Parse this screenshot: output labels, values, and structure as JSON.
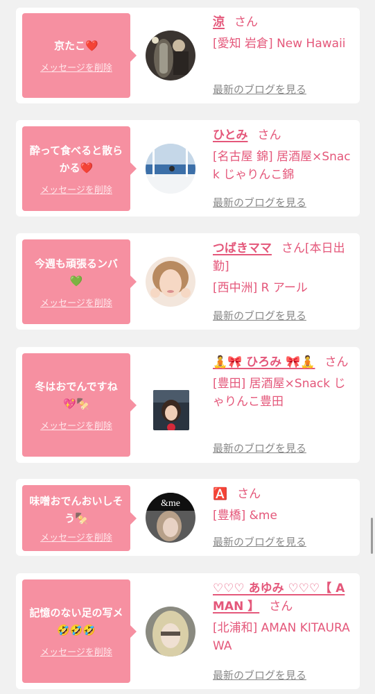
{
  "common": {
    "delete_label": "メッセージを削除",
    "blog_label": "最新のブログを見る",
    "san": "さん"
  },
  "cards": [
    {
      "message": "京たこ❤️",
      "name": "涼",
      "name_suffix": "さん",
      "shop": "[愛知 岩倉] New Hawaii"
    },
    {
      "message": "酔って食べると散らかる❤️",
      "name": "ひとみ",
      "name_suffix": "さん",
      "shop": "[名古屋 錦] 居酒屋×Snack じゃりんこ錦"
    },
    {
      "message": "今週も頑張るンバ💚",
      "name": "つばきママ",
      "name_suffix": "さん[本日出勤]",
      "shop": "[西中洲] R アール"
    },
    {
      "message": "冬はおでんですね💖🍢",
      "name": "🧘🎀 ひろみ 🎀🧘",
      "name_suffix": "さん",
      "shop": "[豊田] 居酒屋×Snack じゃりんこ豊田"
    },
    {
      "message": "味噌おでんおいしそう🍢",
      "name": "🅰️",
      "name_suffix": "さん",
      "shop": "[豊橋] &me"
    },
    {
      "message": "記憶のない足の写メ🤣🤣🤣",
      "name": "♡♡♡ あゆみ ♡♡♡【 AMAN 】",
      "name_suffix": "さん",
      "shop": "[北浦和] AMAN KITAURAWA"
    }
  ],
  "avatar_labels": {
    "card5": "&me"
  },
  "colors": {
    "background": "#f1f1f1",
    "bubble": "#f690a1",
    "accent_pink": "#e4577a",
    "link_gray": "#888888"
  }
}
